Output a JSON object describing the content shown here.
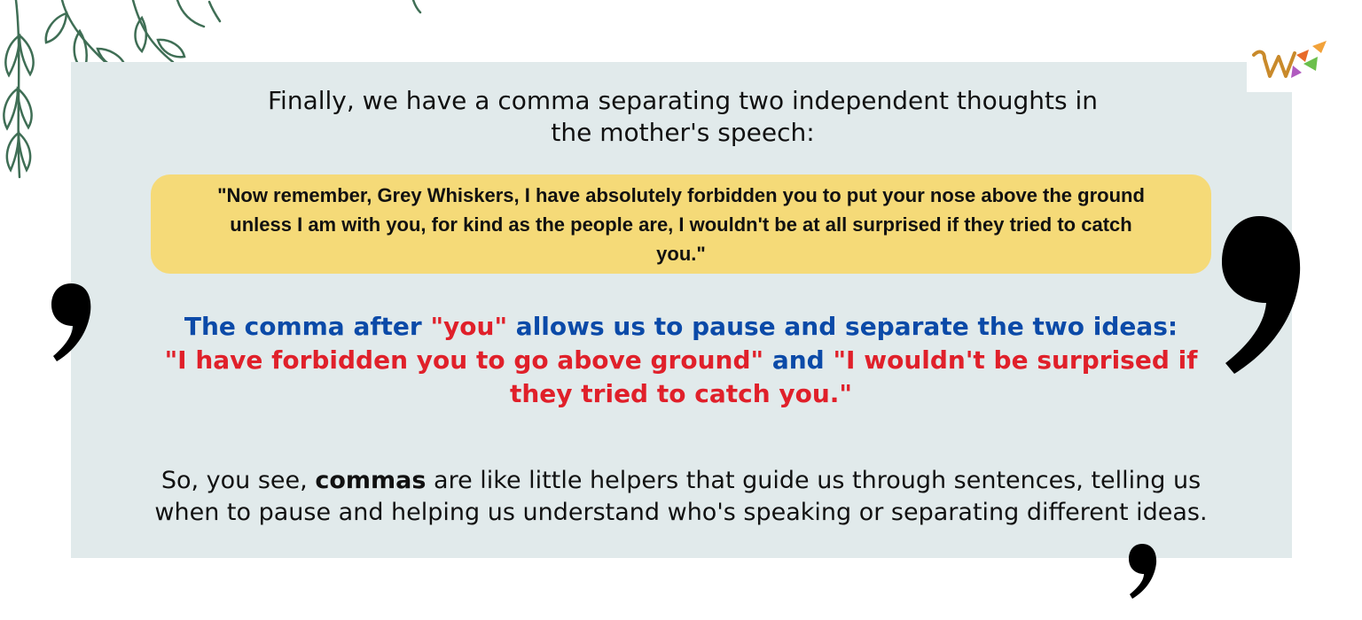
{
  "intro": {
    "line1": "Finally, we have a comma separating two independent thoughts in",
    "line2": "the mother's speech:"
  },
  "quote": {
    "line1": "\"Now remember, Grey Whiskers, I have absolutely forbidden you to put your nose above the ground",
    "line2": "unless I am with you, for kind as the people are, I wouldn't be at all surprised if they tried to catch",
    "line3": "you.\""
  },
  "explanation": {
    "part1": "The comma after ",
    "part2": "\"you\"",
    "part3": " allows us to pause and separate the two ideas:",
    "part4": "\"I have forbidden you to go above ground\"",
    "part5": " and ",
    "part6": "\"I wouldn't be surprised if",
    "part7": "they tried to catch you.\""
  },
  "summary": {
    "part1": "So, you see, ",
    "bold": "commas",
    "part2": " are like little helpers that guide us through sentences, telling us",
    "line2": "when to pause and helping us understand who's speaking or separating different ideas."
  },
  "colors": {
    "panel": "#e1eaeb",
    "quote_box": "#f5da78",
    "blue_text": "#0b4aa8",
    "red_text": "#e0202a",
    "leaf": "#3f6e55"
  },
  "icons": [
    "leaf-branch-decoration",
    "comma-icon",
    "brand-logo-icon"
  ]
}
